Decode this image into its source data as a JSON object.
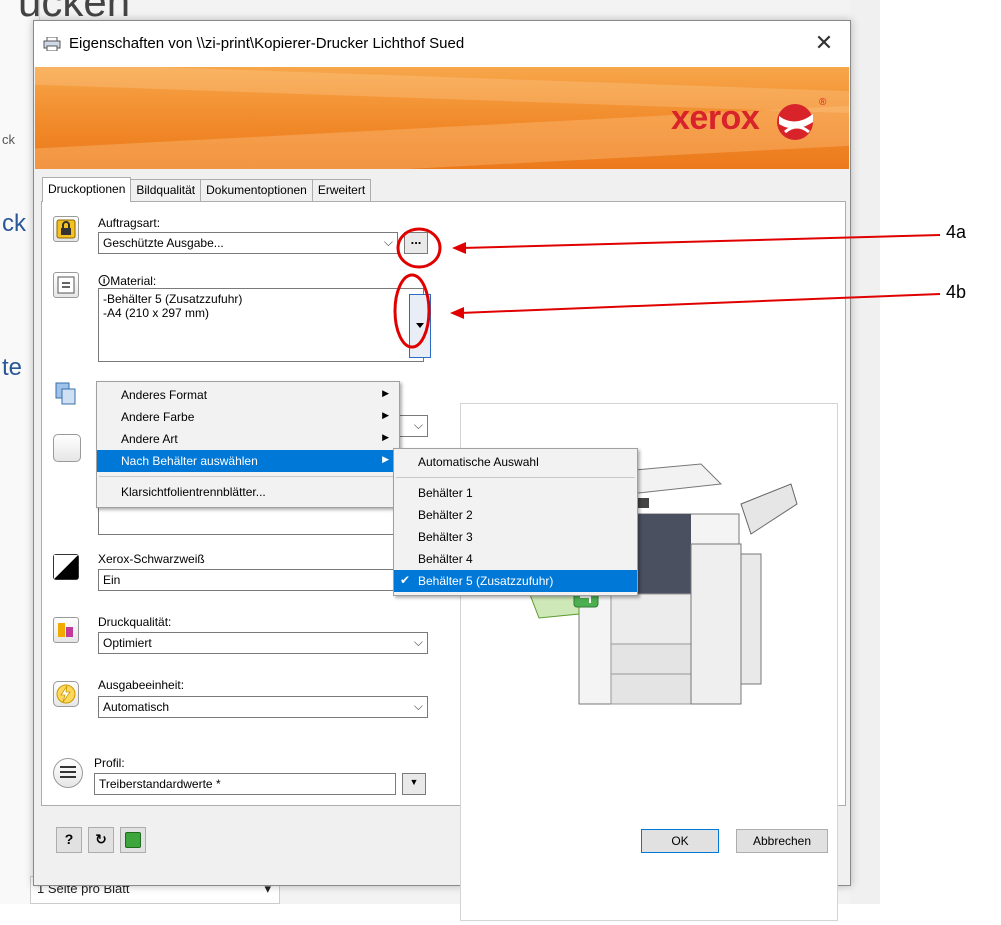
{
  "background_app": {
    "title_fragment": "ucken",
    "fragment_1": "ck",
    "fragment_2": "ck",
    "fragment_3": "te",
    "bottom_select": "1 Seite pro Blatt"
  },
  "dialog": {
    "title": "Eigenschaften von \\\\zi-print\\Kopierer-Drucker Lichthof Sued",
    "logo": "xerox",
    "tabs": [
      {
        "label": "Druckoptionen",
        "active": true
      },
      {
        "label": "Bildqualität",
        "active": false
      },
      {
        "label": "Dokumentoptionen",
        "active": false
      },
      {
        "label": "Erweitert",
        "active": false
      }
    ],
    "auftragsart": {
      "label": "Auftragsart:",
      "value": "Geschützte Ausgabe...",
      "button": "..."
    },
    "material": {
      "label": "Material:",
      "lines": [
        "-Behälter 5 (Zusatzzufuhr)",
        "-A4 (210 x 297 mm)"
      ]
    },
    "schwarzweiss": {
      "label": "Xerox-Schwarzweiß",
      "value": "Ein"
    },
    "druckqualitaet": {
      "label": "Druckqualität:",
      "value": "Optimiert"
    },
    "ausgabeeinheit": {
      "label": "Ausgabeeinheit:",
      "value": "Automatisch"
    },
    "profil": {
      "label": "Profil:",
      "value": "Treiberstandardwerte *"
    },
    "buttons": {
      "help": "?",
      "ok": "OK",
      "cancel": "Abbrechen"
    }
  },
  "material_menu": {
    "items": [
      {
        "label": "Anderes Format",
        "submenu": true
      },
      {
        "label": "Andere Farbe",
        "submenu": true
      },
      {
        "label": "Andere Art",
        "submenu": true
      },
      {
        "label": "Nach Behälter auswählen",
        "submenu": true,
        "highlighted": true
      }
    ],
    "extra_item": "Klarsichtfolientrennblätter..."
  },
  "tray_submenu": {
    "auto": "Automatische Auswahl",
    "items": [
      {
        "label": "Behälter 1",
        "checked": false
      },
      {
        "label": "Behälter 2",
        "checked": false
      },
      {
        "label": "Behälter 3",
        "checked": false
      },
      {
        "label": "Behälter 4",
        "checked": false
      },
      {
        "label": "Behälter 5 (Zusatzzufuhr)",
        "checked": true
      }
    ]
  },
  "callouts": {
    "a": "4a",
    "b": "4b"
  },
  "colors": {
    "banner": "#f18a2a",
    "xerox_red": "#d8232a",
    "highlight": "#0078d7",
    "callout_red": "#e00000"
  }
}
